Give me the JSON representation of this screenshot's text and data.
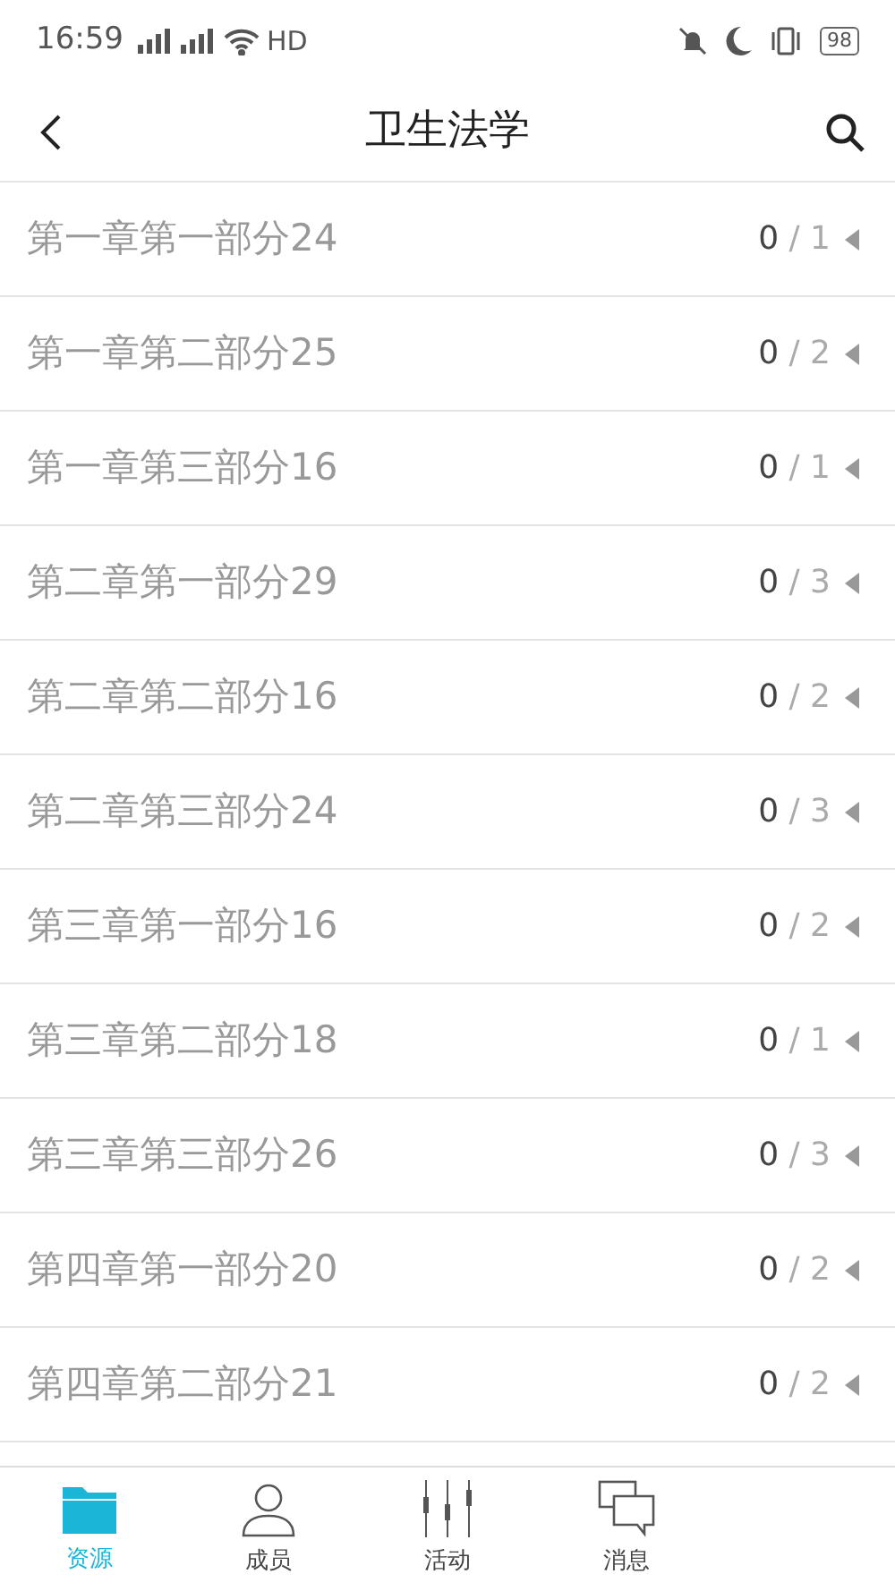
{
  "status_bar": {
    "time": "16:59",
    "network": "HD",
    "battery": "98"
  },
  "header": {
    "title": "卫生法学"
  },
  "items": [
    {
      "title": "第一章第一部分24",
      "done": "0",
      "total": "/ 1"
    },
    {
      "title": "第一章第二部分25",
      "done": "0",
      "total": "/ 2"
    },
    {
      "title": "第一章第三部分16",
      "done": "0",
      "total": "/ 1"
    },
    {
      "title": "第二章第一部分29",
      "done": "0",
      "total": "/ 3"
    },
    {
      "title": "第二章第二部分16",
      "done": "0",
      "total": "/ 2"
    },
    {
      "title": "第二章第三部分24",
      "done": "0",
      "total": "/ 3"
    },
    {
      "title": "第三章第一部分16",
      "done": "0",
      "total": "/ 2"
    },
    {
      "title": "第三章第二部分18",
      "done": "0",
      "total": "/ 1"
    },
    {
      "title": "第三章第三部分26",
      "done": "0",
      "total": "/ 3"
    },
    {
      "title": "第四章第一部分20",
      "done": "0",
      "total": "/ 2"
    },
    {
      "title": "第四章第二部分21",
      "done": "0",
      "total": "/ 2"
    }
  ],
  "tabs": [
    {
      "label": "资源",
      "kind": "folder",
      "selected": true
    },
    {
      "label": "成员",
      "kind": "person",
      "selected": false
    },
    {
      "label": "活动",
      "kind": "sliders",
      "selected": false
    },
    {
      "label": "消息",
      "kind": "chat",
      "selected": false
    }
  ]
}
